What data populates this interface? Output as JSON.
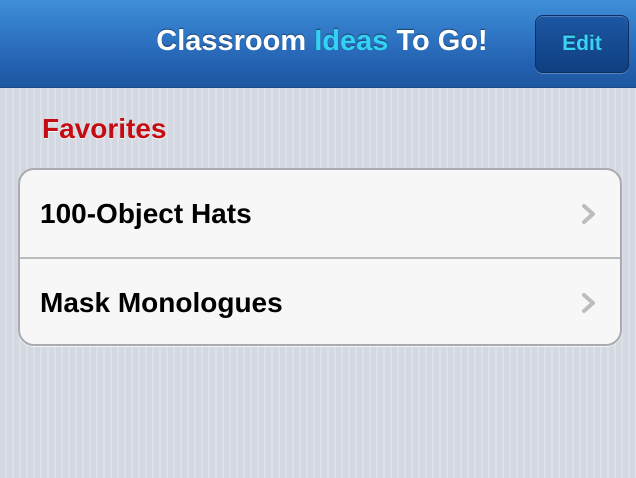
{
  "navbar": {
    "title_part1": "Classroom ",
    "title_part2": "Ideas",
    "title_part3": " To Go!",
    "edit_label": "Edit",
    "colors": {
      "bar": "#2f76c5",
      "title_accent": "#33d1f2",
      "edit_text": "#3ad3f3"
    }
  },
  "section": {
    "header": "Favorites",
    "header_color": "#c40d12"
  },
  "favorites": [
    {
      "label": "100-Object Hats",
      "icon": "chevron-right-icon"
    },
    {
      "label": "Mask Monologues",
      "icon": "chevron-right-icon"
    }
  ]
}
